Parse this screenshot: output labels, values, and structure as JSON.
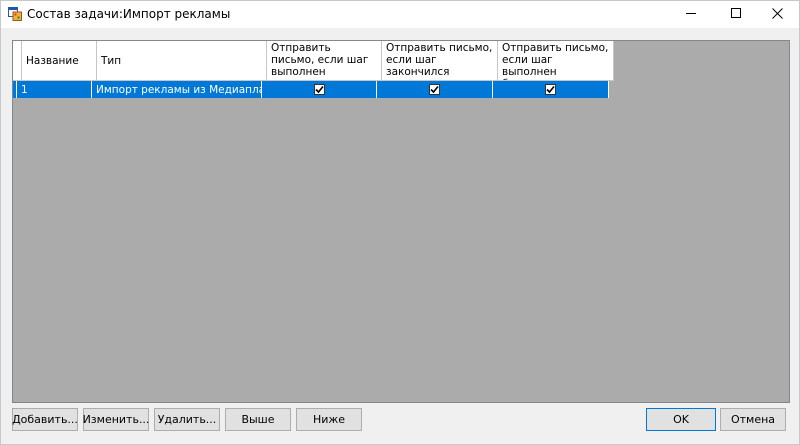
{
  "window": {
    "title": "Состав задачи:Импорт рекламы"
  },
  "table": {
    "headers": [
      "Название",
      "Тип",
      "Отправить письмо, если шаг выполнен успешно",
      "Отправить письмо, если шаг закончился неудачно",
      "Отправить письмо, если шаг выполнен безрезультатно"
    ],
    "rows": [
      {
        "name": "1",
        "type": "Импорт рекламы из Медиапланера",
        "notify_success": true,
        "notify_failure": true,
        "notify_no_result": true
      }
    ],
    "selected_row_color": "#0078d7",
    "empty_area_color": "#ababab"
  },
  "buttons": {
    "add": "Добавить...",
    "edit": "Изменить...",
    "delete": "Удалить...",
    "up": "Выше",
    "down": "Ниже",
    "ok": "OK",
    "cancel": "Отмена"
  },
  "icons": {
    "app": "app-window-icon",
    "minimize": "minimize-icon",
    "maximize": "maximize-icon",
    "close": "close-icon",
    "checkbox": "checkbox-checked-icon"
  }
}
